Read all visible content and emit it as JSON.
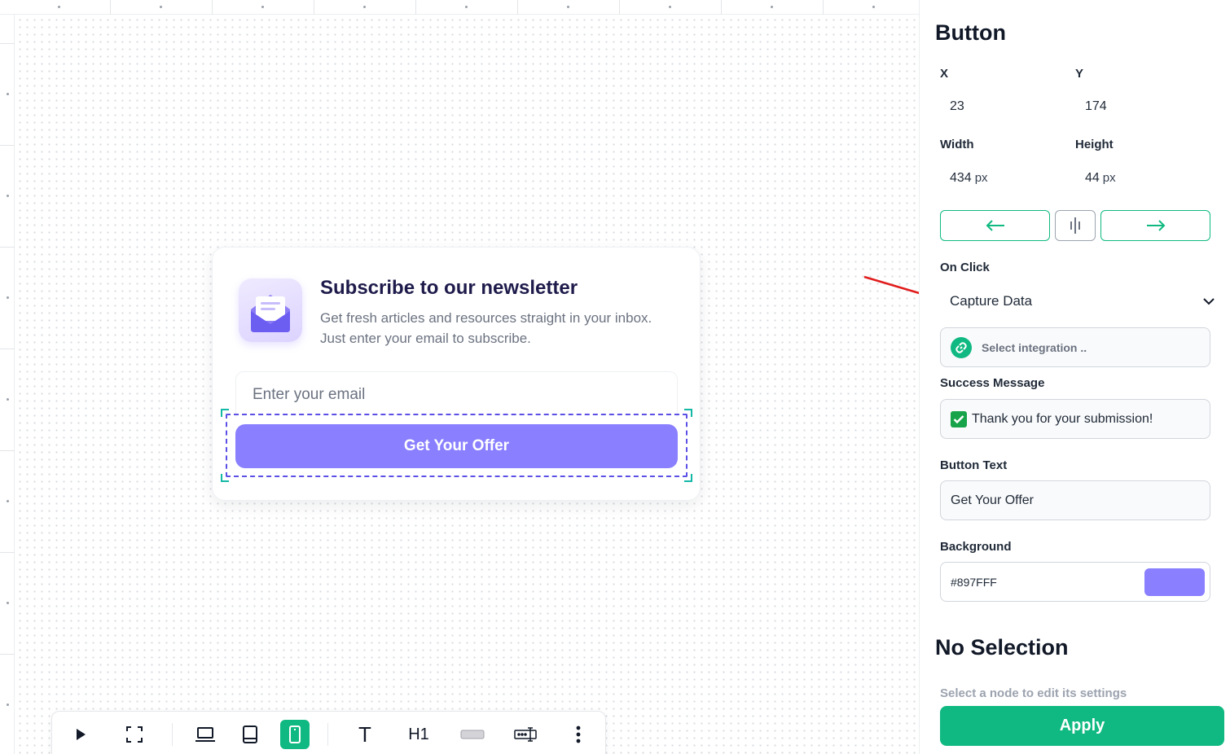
{
  "card": {
    "title": "Subscribe to our newsletter",
    "subtitle": "Get fresh articles and resources straight in your inbox. Just enter your email to subscribe.",
    "email_placeholder": "Enter your email",
    "button_label": "Get Your Offer"
  },
  "toolbar": {
    "icons": [
      "play-icon",
      "fullscreen-icon",
      "desktop-icon",
      "tablet-icon",
      "mobile-icon",
      "text-icon",
      "heading-icon",
      "button-element-icon",
      "input-element-icon",
      "more-icon"
    ],
    "heading_glyph": "H1",
    "text_glyph": "T",
    "active": "mobile-icon"
  },
  "panel": {
    "title": "Button",
    "x_label": "X",
    "x_value": "23",
    "y_label": "Y",
    "y_value": "174",
    "width_label": "Width",
    "width_value": "434",
    "height_label": "Height",
    "height_value": "44",
    "unit": "px",
    "on_click_label": "On Click",
    "on_click_value": "Capture Data",
    "integration_placeholder": "Select integration ..",
    "success_label": "Success Message",
    "success_value": "Thank you for your submission!",
    "button_text_label": "Button Text",
    "button_text_value": "Get Your Offer",
    "background_label": "Background",
    "background_value": "#897FFF",
    "no_selection_title": "No Selection",
    "no_selection_sub": "Select a node to edit its settings",
    "apply_label": "Apply"
  },
  "colors": {
    "accent": "#10b981",
    "button_bg": "#897FFF",
    "selection": "#5b50e6",
    "annotation_arrow": "#e11d1d"
  }
}
